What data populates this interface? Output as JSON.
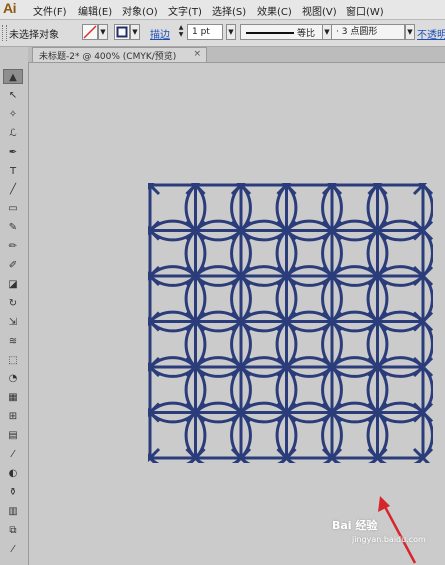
{
  "app": {
    "logo": "Ai"
  },
  "menu": [
    {
      "label": "文件(F)"
    },
    {
      "label": "编辑(E)"
    },
    {
      "label": "对象(O)"
    },
    {
      "label": "文字(T)"
    },
    {
      "label": "选择(S)"
    },
    {
      "label": "效果(C)"
    },
    {
      "label": "视图(V)"
    },
    {
      "label": "窗口(W)"
    }
  ],
  "control_bar": {
    "selection_status": "未选择对象",
    "stroke_label": "描边",
    "stroke_weight": "1 pt",
    "profile_label": "等比",
    "brush": "3 点圆形",
    "opacity_label": "不透明"
  },
  "document_tab": {
    "title": "未标题-2* @ 400% (CMYK/预览)",
    "close_glyph": "×"
  },
  "tools": [
    {
      "name": "selection-tool",
      "glyph": "▲"
    },
    {
      "name": "direct-selection-tool",
      "glyph": "↖"
    },
    {
      "name": "magic-wand-tool",
      "glyph": "✧"
    },
    {
      "name": "lasso-tool",
      "glyph": "ℒ"
    },
    {
      "name": "pen-tool",
      "glyph": "✒"
    },
    {
      "name": "type-tool",
      "glyph": "T"
    },
    {
      "name": "line-tool",
      "glyph": "╱"
    },
    {
      "name": "rectangle-tool",
      "glyph": "▭"
    },
    {
      "name": "paintbrush-tool",
      "glyph": "✎"
    },
    {
      "name": "pencil-tool",
      "glyph": "✏"
    },
    {
      "name": "blob-brush-tool",
      "glyph": "✐"
    },
    {
      "name": "eraser-tool",
      "glyph": "◪"
    },
    {
      "name": "rotate-tool",
      "glyph": "↻"
    },
    {
      "name": "scale-tool",
      "glyph": "⇲"
    },
    {
      "name": "warp-tool",
      "glyph": "≋"
    },
    {
      "name": "free-transform-tool",
      "glyph": "⬚"
    },
    {
      "name": "shape-builder-tool",
      "glyph": "◔"
    },
    {
      "name": "perspective-grid-tool",
      "glyph": "▦"
    },
    {
      "name": "mesh-tool",
      "glyph": "⊞"
    },
    {
      "name": "gradient-tool",
      "glyph": "▤"
    },
    {
      "name": "eyedropper-tool",
      "glyph": "⁄"
    },
    {
      "name": "blend-tool",
      "glyph": "◐"
    },
    {
      "name": "symbol-sprayer-tool",
      "glyph": "⚱"
    },
    {
      "name": "column-graph-tool",
      "glyph": "▥"
    },
    {
      "name": "artboard-tool",
      "glyph": "⧉"
    },
    {
      "name": "slice-tool",
      "glyph": "⁄"
    }
  ],
  "colors": {
    "pattern": "#2b3c7b",
    "arrow": "#d7262b",
    "stroke_none": "#d9312f"
  },
  "watermark": {
    "text": "Bai 经验",
    "sub": "jingyan.baidu.com"
  }
}
